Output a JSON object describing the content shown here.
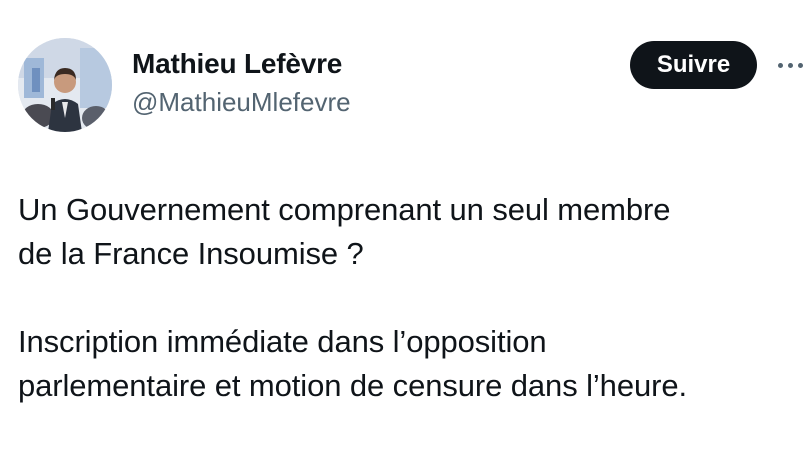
{
  "author": {
    "display_name": "Mathieu Lefèvre",
    "handle": "@MathieuMlefevre",
    "avatar_icon": "profile-photo"
  },
  "follow_button": {
    "label": "Suivre"
  },
  "more_icon": "more-dots-icon",
  "tweet": {
    "paragraph_1": "Un Gouvernement comprenant un seul membre\nde la France Insoumise ?",
    "paragraph_2": "Inscription immédiate dans l’opposition\nparlementaire et motion de censure dans l’heure."
  },
  "colors": {
    "text": "#0f1419",
    "secondary_text": "#536471",
    "button_bg": "#0f1419",
    "button_text": "#ffffff",
    "background": "#ffffff"
  }
}
